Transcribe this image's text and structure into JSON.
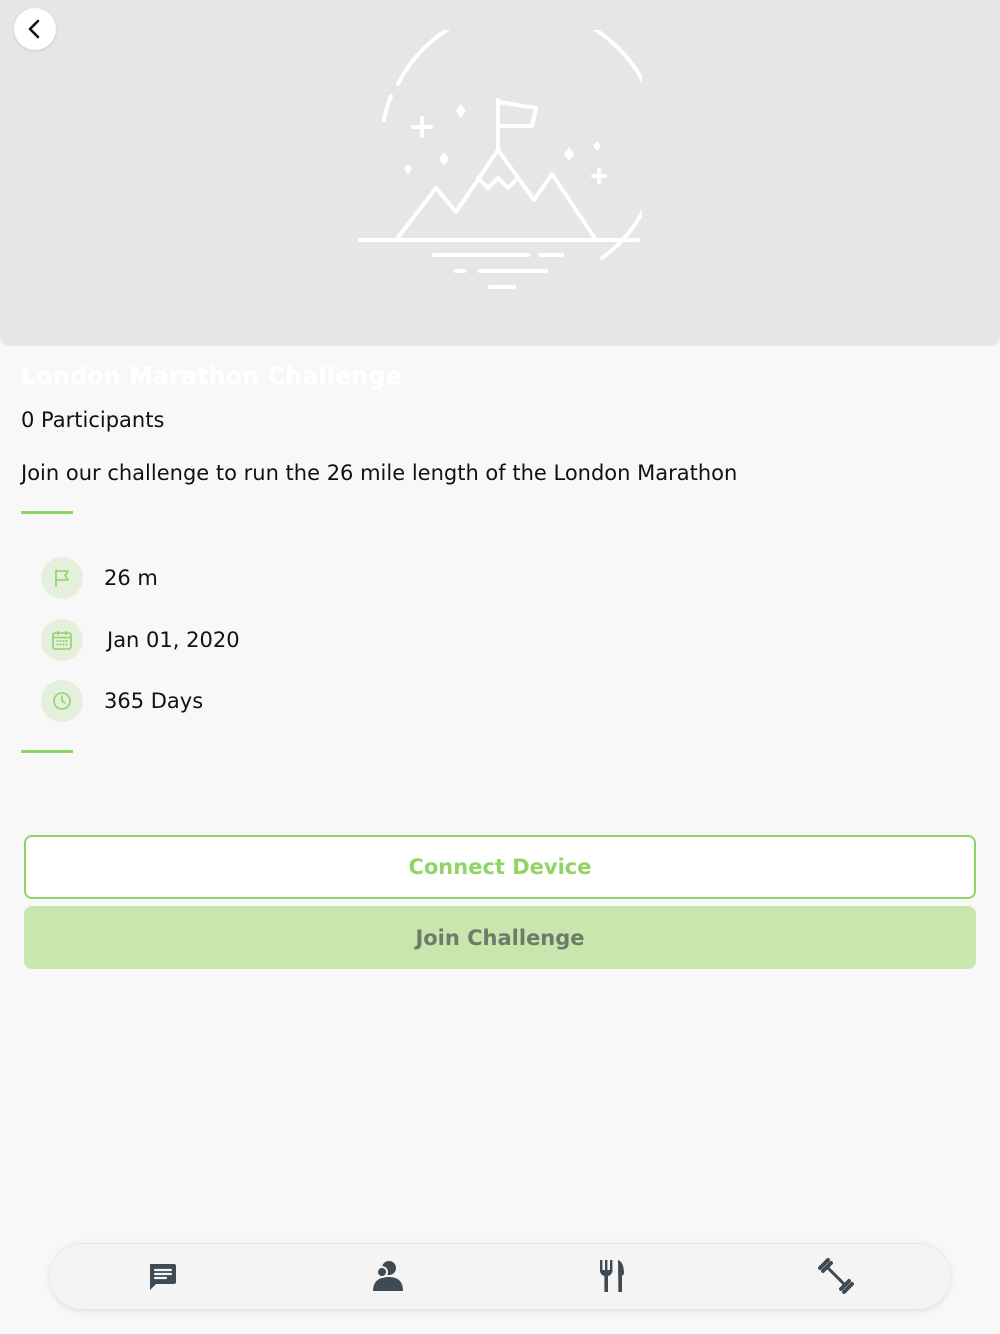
{
  "hero": {
    "back_icon": "chevron-left-icon",
    "illustration": "mountain-flag-icon"
  },
  "challenge": {
    "title": "London Marathon Challenge",
    "participants": "0 Participants",
    "description": "Join our challenge to run the 26 mile length of the London Marathon"
  },
  "stats": [
    {
      "icon": "flag-icon",
      "value": "26 m"
    },
    {
      "icon": "calendar-icon",
      "value": "Jan 01, 2020"
    },
    {
      "icon": "clock-icon",
      "value": "365 Days"
    }
  ],
  "actions": {
    "connect_label": "Connect Device",
    "join_label": "Join Challenge"
  },
  "tabbar": {
    "items": [
      {
        "icon": "chat-icon"
      },
      {
        "icon": "profile-icon"
      },
      {
        "icon": "cutlery-icon"
      },
      {
        "icon": "dumbbell-icon"
      }
    ]
  },
  "colors": {
    "accent": "#8fd466",
    "join_bg": "#c8e6ad",
    "hero_bg": "#e6e6e6",
    "icon_dark": "#3f4a53"
  }
}
